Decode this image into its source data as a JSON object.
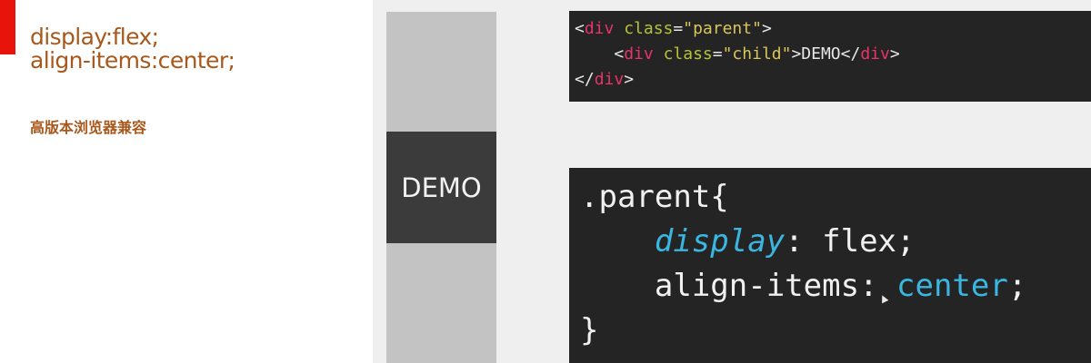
{
  "slide": {
    "title_line1": "display:flex;",
    "title_line2": "align-items:center;",
    "subtitle": "高版本浏览器兼容"
  },
  "demo": {
    "label": "DEMO"
  },
  "code_html": {
    "l1": {
      "open": "<",
      "tag": "div",
      "attr": "class",
      "eq": "=",
      "val": "\"parent\"",
      "close": ">"
    },
    "l2": {
      "indent": "    ",
      "open": "<",
      "tag": "div",
      "attr": "class",
      "eq": "=",
      "val": "\"child\"",
      "close": ">",
      "text": "DEMO",
      "end_open": "</",
      "end_tag": "div",
      "end_close": ">"
    },
    "l3": {
      "open": "</",
      "tag": "div",
      "close": ">"
    }
  },
  "code_css": {
    "selector": ".parent{",
    "indent": "    ",
    "prop1": "display",
    "colon1": ": flex;",
    "prop2": "align-items",
    "colon2": ": ",
    "val2": "center",
    "semi2": ";",
    "close": "}"
  },
  "colors": {
    "accent": "#e8140c",
    "heading": "#a8581b",
    "code_bg": "#242424",
    "demo_bg": "#3b3b3b",
    "column_gray": "#c3c3c3",
    "tag_pink": "#e8336b",
    "attr_green": "#b9c236",
    "string_yellow": "#d9c65a",
    "keyword_blue": "#3ab6e0"
  },
  "icons": {
    "cursor": "mouse-pointer-icon"
  }
}
